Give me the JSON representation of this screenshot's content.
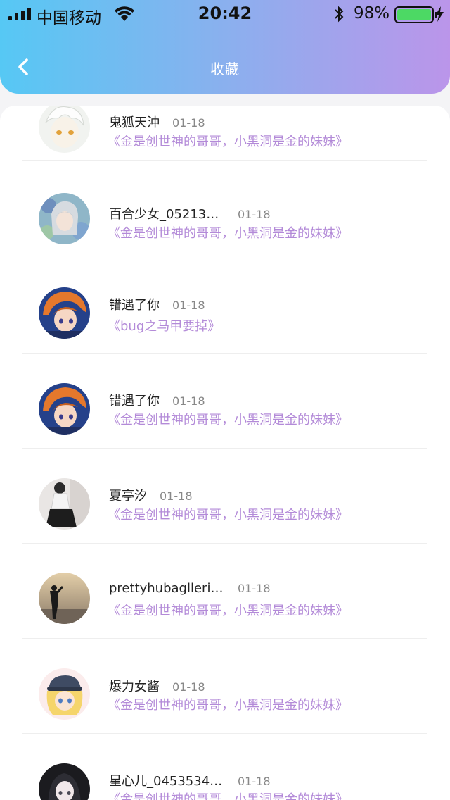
{
  "status_bar": {
    "carrier": "中国移动",
    "time": "20:42",
    "battery": "98%"
  },
  "header": {
    "title": "收藏",
    "gradient": [
      "#56c8f4",
      "#bb95ea"
    ]
  },
  "items": [
    {
      "name": "鬼狐天沖",
      "date": "01-18",
      "book": "《金是创世神的哥哥，小黑洞是金的妹妹》",
      "avatar": "white-hair-anime-avatar"
    },
    {
      "name": "百合少女_052130...",
      "date": "01-18",
      "book": "《金是创世神的哥哥，小黑洞是金的妹妹》",
      "avatar": "flower-girl-anime-avatar"
    },
    {
      "name": "错遇了你",
      "date": "01-18",
      "book": "《bug之马甲要掉》",
      "avatar": "orange-hair-anime-avatar"
    },
    {
      "name": "错遇了你",
      "date": "01-18",
      "book": "《金是创世神的哥哥，小黑洞是金的妹妹》",
      "avatar": "orange-hair-anime-avatar"
    },
    {
      "name": "夏亭汐",
      "date": "01-18",
      "book": "《金是创世神的哥哥，小黑洞是金的妹妹》",
      "avatar": "black-dress-photo-avatar"
    },
    {
      "name": "prettyhubagllerin...",
      "date": "01-18",
      "book": "《金是创世神的哥哥，小黑洞是金的妹妹》",
      "avatar": "silhouette-photo-avatar"
    },
    {
      "name": "爆力女酱",
      "date": "01-18",
      "book": "《金是创世神的哥哥，小黑洞是金的妹妹》",
      "avatar": "blonde-cap-anime-avatar"
    },
    {
      "name": "星心儿_04535347...",
      "date": "01-18",
      "book": "《金是创世神的哥哥，小黑洞是金的妹妹》",
      "avatar": "dark-hair-anime-avatar"
    }
  ],
  "colors": {
    "book_title": "#b38ad8",
    "name": "#222222",
    "date": "#888888"
  }
}
